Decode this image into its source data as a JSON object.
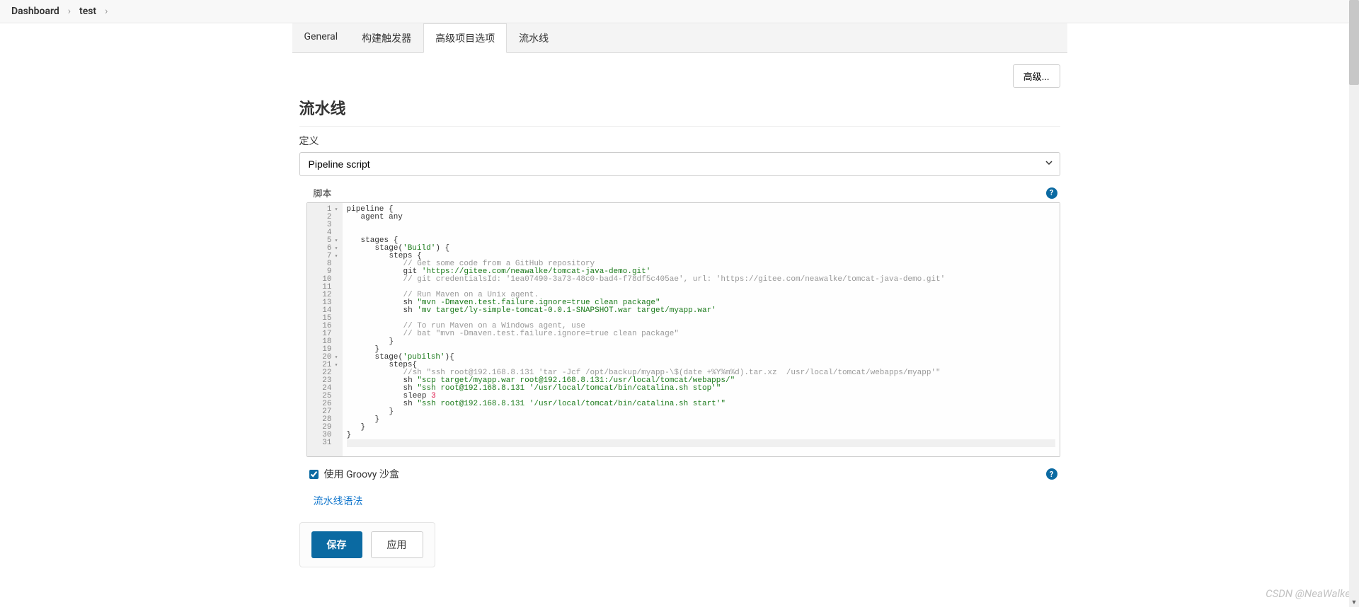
{
  "breadcrumb": {
    "root": "Dashboard",
    "item": "test"
  },
  "tabs": {
    "general": "General",
    "triggers": "构建触发器",
    "advanced": "高级项目选项",
    "pipeline": "流水线"
  },
  "advanced_btn": "高级...",
  "section_title": "流水线",
  "definition_label": "定义",
  "definition_value": "Pipeline script",
  "script_label": "脚本",
  "sandbox_label": "使用 Groovy 沙盒",
  "syntax_link": "流水线语法",
  "save_btn": "保存",
  "apply_btn": "应用",
  "watermark": "CSDN @NeaWalke",
  "code_lines": [
    {
      "n": 1,
      "fold": true,
      "segs": [
        {
          "t": "pipeline {",
          "c": "kw"
        }
      ]
    },
    {
      "n": 2,
      "segs": [
        {
          "pad": 2
        },
        {
          "t": "agent any"
        }
      ]
    },
    {
      "n": 3,
      "segs": []
    },
    {
      "n": 4,
      "segs": []
    },
    {
      "n": 5,
      "fold": true,
      "segs": [
        {
          "pad": 2
        },
        {
          "t": "stages {"
        }
      ]
    },
    {
      "n": 6,
      "fold": true,
      "segs": [
        {
          "pad": 4
        },
        {
          "t": "stage("
        },
        {
          "t": "'Build'",
          "c": "str"
        },
        {
          "t": ") {"
        }
      ]
    },
    {
      "n": 7,
      "fold": true,
      "segs": [
        {
          "pad": 6
        },
        {
          "t": "steps {"
        }
      ]
    },
    {
      "n": 8,
      "segs": [
        {
          "pad": 8
        },
        {
          "t": "// Get some code from a GitHub repository",
          "c": "cmt"
        }
      ]
    },
    {
      "n": 9,
      "segs": [
        {
          "pad": 8
        },
        {
          "t": "git "
        },
        {
          "t": "'https://gitee.com/neawalke/tomcat-java-demo.git'",
          "c": "str"
        }
      ]
    },
    {
      "n": 10,
      "segs": [
        {
          "pad": 8
        },
        {
          "t": "// git credentialsId: '1ea07490-3a73-48c0-bad4-f78df5c405ae', url: 'https://gitee.com/neawalke/tomcat-java-demo.git'",
          "c": "cmt"
        }
      ]
    },
    {
      "n": 11,
      "segs": []
    },
    {
      "n": 12,
      "segs": [
        {
          "pad": 8
        },
        {
          "t": "// Run Maven on a Unix agent.",
          "c": "cmt"
        }
      ]
    },
    {
      "n": 13,
      "segs": [
        {
          "pad": 8
        },
        {
          "t": "sh "
        },
        {
          "t": "\"mvn -Dmaven.test.failure.ignore=true clean package\"",
          "c": "str"
        }
      ]
    },
    {
      "n": 14,
      "segs": [
        {
          "pad": 8
        },
        {
          "t": "sh "
        },
        {
          "t": "'mv target/ly-simple-tomcat-0.0.1-SNAPSHOT.war target/myapp.war'",
          "c": "str"
        }
      ]
    },
    {
      "n": 15,
      "segs": []
    },
    {
      "n": 16,
      "segs": [
        {
          "pad": 8
        },
        {
          "t": "// To run Maven on a Windows agent, use",
          "c": "cmt"
        }
      ]
    },
    {
      "n": 17,
      "segs": [
        {
          "pad": 8
        },
        {
          "t": "// bat \"mvn -Dmaven.test.failure.ignore=true clean package\"",
          "c": "cmt"
        }
      ]
    },
    {
      "n": 18,
      "segs": [
        {
          "pad": 6
        },
        {
          "t": "}"
        }
      ]
    },
    {
      "n": 19,
      "segs": [
        {
          "pad": 4
        },
        {
          "t": "}"
        }
      ]
    },
    {
      "n": 20,
      "fold": true,
      "segs": [
        {
          "pad": 4
        },
        {
          "t": "stage("
        },
        {
          "t": "'pubilsh'",
          "c": "str"
        },
        {
          "t": "){"
        }
      ]
    },
    {
      "n": 21,
      "fold": true,
      "segs": [
        {
          "pad": 6
        },
        {
          "t": "steps{"
        }
      ]
    },
    {
      "n": 22,
      "segs": [
        {
          "pad": 8
        },
        {
          "t": "//sh \"ssh root@192.168.8.131 'tar -Jcf /opt/backup/myapp-\\$(date +%Y%m%d).tar.xz  /usr/local/tomcat/webapps/myapp'\"",
          "c": "cmt"
        }
      ]
    },
    {
      "n": 23,
      "segs": [
        {
          "pad": 8
        },
        {
          "t": "sh "
        },
        {
          "t": "\"scp target/myapp.war root@192.168.8.131:/usr/local/tomcat/webapps/\"",
          "c": "str"
        }
      ]
    },
    {
      "n": 24,
      "segs": [
        {
          "pad": 8
        },
        {
          "t": "sh "
        },
        {
          "t": "\"ssh root@192.168.8.131 '/usr/local/tomcat/bin/catalina.sh stop'\"",
          "c": "str"
        }
      ]
    },
    {
      "n": 25,
      "segs": [
        {
          "pad": 8
        },
        {
          "t": "sleep "
        },
        {
          "t": "3",
          "c": "num"
        }
      ]
    },
    {
      "n": 26,
      "segs": [
        {
          "pad": 8
        },
        {
          "t": "sh "
        },
        {
          "t": "\"ssh root@192.168.8.131 '/usr/local/tomcat/bin/catalina.sh start'\"",
          "c": "str"
        }
      ]
    },
    {
      "n": 27,
      "segs": [
        {
          "pad": 6
        },
        {
          "t": "}"
        }
      ]
    },
    {
      "n": 28,
      "segs": [
        {
          "pad": 4
        },
        {
          "t": "}"
        }
      ]
    },
    {
      "n": 29,
      "segs": [
        {
          "pad": 2
        },
        {
          "t": "}"
        }
      ]
    },
    {
      "n": 30,
      "segs": [
        {
          "t": "}"
        }
      ]
    },
    {
      "n": 31,
      "cursor": true,
      "segs": []
    }
  ]
}
